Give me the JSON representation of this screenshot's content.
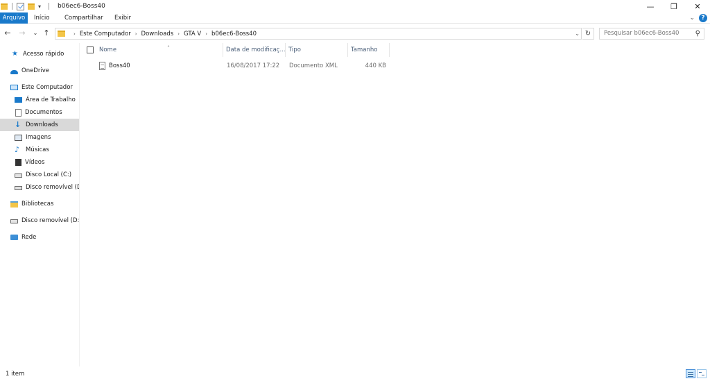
{
  "window": {
    "title": "b06ec6-Boss40",
    "minimize_glyph": "—",
    "restore_glyph": "❐",
    "close_glyph": "✕"
  },
  "ribbon": {
    "tabs": [
      "Arquivo",
      "Início",
      "Compartilhar",
      "Exibir"
    ],
    "help_glyph": "?"
  },
  "address": {
    "breadcrumbs": [
      "Este Computador",
      "Downloads",
      "GTA V",
      "b06ec6-Boss40"
    ]
  },
  "search": {
    "placeholder": "Pesquisar b06ec6-Boss40"
  },
  "nav": {
    "items": [
      {
        "label": "Acesso rápido",
        "icon": "star-icon"
      },
      {
        "label": "OneDrive",
        "icon": "cloud-icon"
      },
      {
        "label": "Este Computador",
        "icon": "computer-icon"
      },
      {
        "label": "Área de Trabalho",
        "icon": "desktop-icon"
      },
      {
        "label": "Documentos",
        "icon": "document-icon"
      },
      {
        "label": "Downloads",
        "icon": "download-icon",
        "selected": true
      },
      {
        "label": "Imagens",
        "icon": "pictures-icon"
      },
      {
        "label": "Músicas",
        "icon": "music-icon"
      },
      {
        "label": "Vídeos",
        "icon": "video-icon"
      },
      {
        "label": "Disco Local (C:)",
        "icon": "drive-icon"
      },
      {
        "label": "Disco removível (D:",
        "icon": "removable-drive-icon"
      },
      {
        "label": "Bibliotecas",
        "icon": "libraries-icon"
      },
      {
        "label": "Disco removível (D:)",
        "icon": "removable-drive-icon"
      },
      {
        "label": "Rede",
        "icon": "network-icon"
      }
    ]
  },
  "list": {
    "columns": [
      "Nome",
      "Data de modificaç...",
      "Tipo",
      "Tamanho"
    ],
    "sort_column": "Nome",
    "rows": [
      {
        "name": "Boss40",
        "modified": "16/08/2017 17:22",
        "type": "Documento XML",
        "size": "440 KB"
      }
    ]
  },
  "status": {
    "item_count": "1 item"
  },
  "colors": {
    "accent": "#1979ca",
    "selected_nav": "#d9d9d9",
    "header_text": "#4c607a"
  }
}
